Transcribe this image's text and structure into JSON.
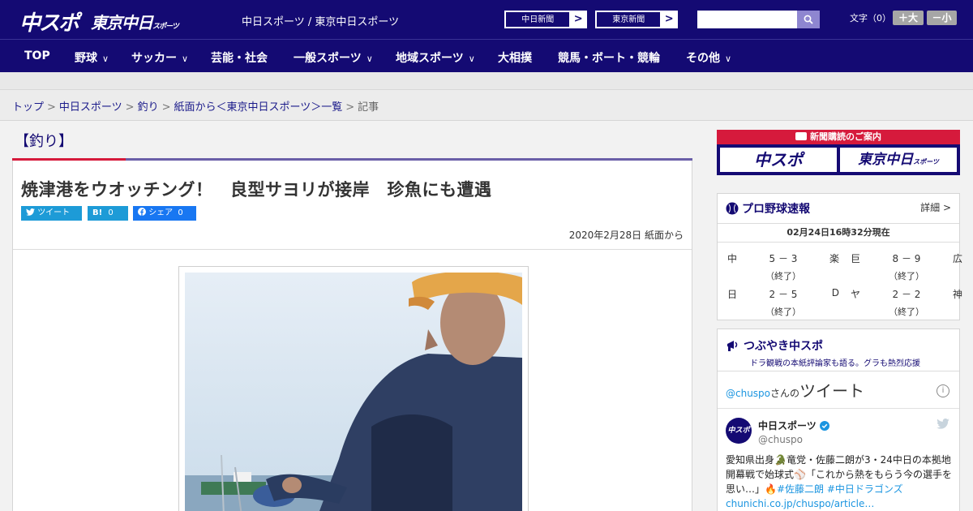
{
  "header": {
    "logo_main": "中スポ",
    "logo_tokyo": "東京中日",
    "logo_tokyo_small": "スポーツ",
    "site_links": "中日スポーツ / 東京中日スポーツ",
    "buttons": [
      {
        "label": "中日新聞",
        "arrow": ">"
      },
      {
        "label": "東京新聞",
        "arrow": ">"
      }
    ],
    "search_placeholder": "",
    "font_size_label": "文字（0）",
    "font_larger": "＋大",
    "font_smaller": "－小"
  },
  "nav": {
    "items": [
      {
        "label": "TOP",
        "chev": ""
      },
      {
        "label": "野球",
        "chev": "∨"
      },
      {
        "label": "サッカー",
        "chev": "∨"
      },
      {
        "label": "芸能・社会",
        "chev": ""
      },
      {
        "label": "一般スポーツ",
        "chev": "∨"
      },
      {
        "label": "地域スポーツ",
        "chev": "∨"
      },
      {
        "label": "大相撲",
        "chev": ""
      },
      {
        "label": "競馬・ボート・競輪",
        "chev": ""
      },
      {
        "label": "その他",
        "chev": "∨"
      }
    ]
  },
  "breadcrumb": {
    "items": [
      "トップ",
      "中日スポーツ",
      "釣り",
      "紙面から＜東京中日スポーツ＞一覧"
    ],
    "current": "記事",
    "sep": ">"
  },
  "article": {
    "category": "【釣り】",
    "title": "焼津港をウオッチング！　良型サヨリが接岸　珍魚にも遭遇",
    "share": [
      {
        "label": "ツイート"
      },
      {
        "label": "B!",
        "count": "0"
      },
      {
        "label": "シェア",
        "count": "0"
      }
    ],
    "date": "2020年2月28日 紙面から"
  },
  "sidebar": {
    "subscribe": {
      "heading": "新聞購読のご案内",
      "logo1": "中スポ",
      "logo2": "東京中日",
      "logo2_small": "スポーツ"
    },
    "baseball": {
      "title": "プロ野球速報",
      "more": "詳細 >",
      "time": "02月24日16時32分現在",
      "games": [
        {
          "home": "中",
          "score": "5 － 3",
          "away": "楽",
          "status": "（終了）"
        },
        {
          "home": "巨",
          "score": "8 － 9",
          "away": "広",
          "status": "（終了）"
        },
        {
          "home": "日",
          "score": "2 － 5",
          "away": "D",
          "status": "（終了）"
        },
        {
          "home": "ヤ",
          "score": "2 － 2",
          "away": "神",
          "status": "（終了）"
        }
      ]
    },
    "twitter": {
      "title": "つぶやき中スポ",
      "subtitle": "ドラ観戦の本紙評論家も語る。グラも熱烈応援",
      "handle_link": "@chuspo",
      "san_no": "さんの",
      "tweet_label": "ツイート",
      "info": "i",
      "avatar_text": "中スポ",
      "name": "中日スポーツ",
      "handle": "@chuspo",
      "text1": "愛知県出身🐊竜党・佐藤二朗が3・24中日の本拠地開幕戦で始球式⚾「これから熱をもらう今の選手を思い…」🔥",
      "tags": "#佐藤二朗 #中日ドラゴンズ",
      "link": "chunichi.co.jp/chuspo/article…"
    }
  },
  "colors": {
    "navy": "#140a73",
    "accent_red": "#d61a3c",
    "twitter_blue": "#1d9bd7",
    "facebook_blue": "#1877f2"
  }
}
